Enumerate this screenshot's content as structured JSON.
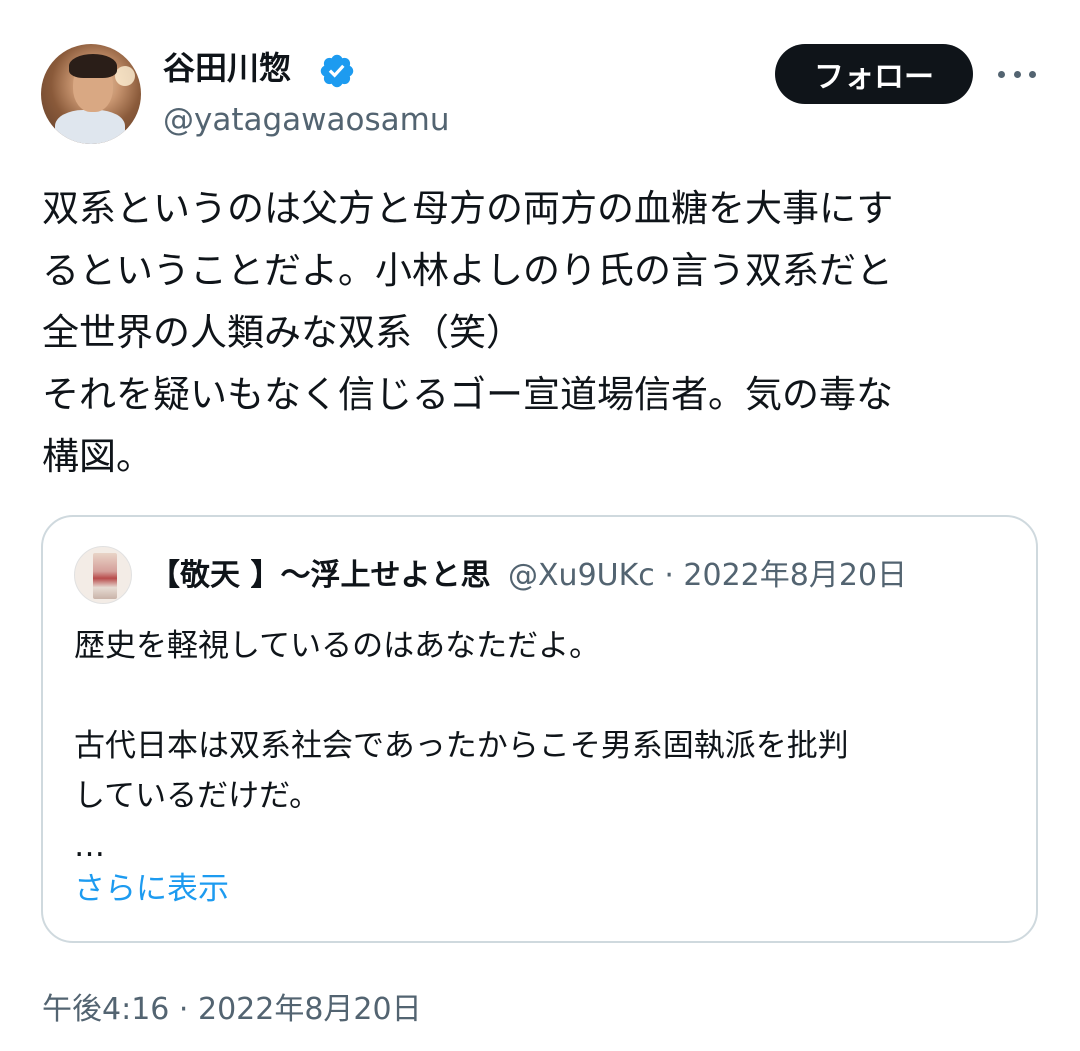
{
  "author": {
    "display_name": "谷田川惣",
    "handle": "@yatagawaosamu",
    "avatar_icon": "user-avatar",
    "verified_icon": "verified-badge-icon",
    "verified_color": "#1d9bf0"
  },
  "actions": {
    "follow_label": "フォロー",
    "more_icon": "more-options-icon"
  },
  "tweet": {
    "lines": [
      "双系というのは父方と母方の両方の血糖を大事にす",
      "るということだよ。小林よしのり氏の言う双系だと",
      "全世界の人類みな双系（笑）",
      "それを疑いもなく信じるゴー宣道場信者。気の毒な",
      "構図。"
    ],
    "timestamp": "午後4:16 · 2022年8月20日"
  },
  "quote": {
    "display_name": "【敬天 】〜浮上せよと思",
    "handle": "@Xu9UKc",
    "separator": "·",
    "date": "2022年8月20日",
    "lines": [
      "歴史を軽視しているのはあなただよ。",
      "古代日本は双系社会であったからこそ男系固執派を批判",
      "しているだけだ。",
      "…"
    ],
    "show_more_label": "さらに表示"
  },
  "colors": {
    "text_primary": "#0f1419",
    "text_secondary": "#536471",
    "link": "#1d9bf0",
    "border": "#cfd9de",
    "button_bg": "#0f1419"
  }
}
